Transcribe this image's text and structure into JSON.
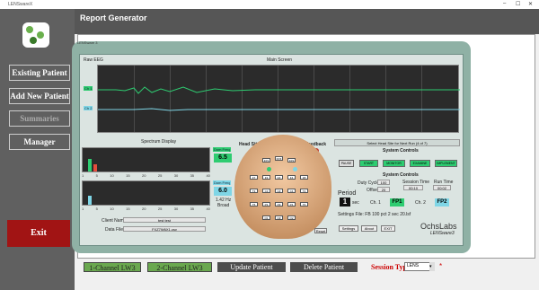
{
  "window": {
    "title": "LENSwareX",
    "controls": [
      "–",
      "☐",
      "✕"
    ]
  },
  "app": {
    "report_title": "Report Generator"
  },
  "sidebar": {
    "buttons": [
      {
        "label": "Existing Patient",
        "bg": "#6aa84f"
      },
      {
        "label": "Add New Patient",
        "bg": "#7a7a7a"
      },
      {
        "label": "Summaries",
        "bg": "#7a7a7a"
      },
      {
        "label": "Manager",
        "bg": "#7a7a7a"
      }
    ],
    "exit": "Exit"
  },
  "bottom": {
    "buttons": [
      "1-Channel LW3",
      "2-Channel LW3",
      "Update Patient",
      "Delete Patient"
    ],
    "session_label": "Session Type:",
    "session_value": "LENS",
    "asterisk": "*"
  },
  "lens": {
    "tab": "Existing Patient",
    "title": "LENSware 3",
    "raw_eeg": "Raw EEG",
    "main_screen": "Main Screen",
    "ch1": "Ch 1",
    "ch2": "Ch 2",
    "spectrum_title": "Spectrum Display",
    "spectrum_ticks": [
      "1",
      "5",
      "10",
      "15",
      "20",
      "25",
      "30",
      "35",
      "40"
    ],
    "dom_freq_label": "Dom Freq",
    "dom_freq_1": "6.5",
    "dom_freq_2": "6.0",
    "dom_freq_2_sub": "1.42 Hz",
    "dom_freq_2_sub2": "Broad",
    "head_sites": "Head Sites",
    "feedback": "Feedback",
    "sites": [
      "FP1",
      "FPZ",
      "FP2",
      "F7",
      "F3",
      "FZ",
      "F4",
      "F8",
      "T3",
      "C3",
      "CZ",
      "C4",
      "T4",
      "T5",
      "P3",
      "PZ",
      "P4",
      "T6",
      "O1",
      "OZ",
      "O2"
    ],
    "reset": "Reset",
    "select_head_site": "Select Head Site for Next Run (4 of 7)",
    "system_controls": "System Controls",
    "sys_buttons": [
      "PAUSE",
      "START",
      "MONITOR",
      "EXAMINE",
      "IMPLEMENT"
    ],
    "system_controls_2": "System Controls",
    "duty_cycle_label": "Duty Cycle",
    "duty_cycle": "100",
    "offset_label": "Offset",
    "offset": "20",
    "session_time_label": "Session Time",
    "session_time": "00:10",
    "run_time_label": "Run Time",
    "run_time": "00:02",
    "period_label": "Period",
    "period": "1",
    "period_unit": "sec",
    "ch1_label": "Ch. 1",
    "ch1_site": "FP1",
    "ch2_label": "Ch. 2",
    "ch2_site": "FP2",
    "settings_file": "Settings File: FB 100 pct 2 sec 20.lsf",
    "client_name_label": "Client Name:",
    "client_name": "test test",
    "data_file_label": "Data File:",
    "data_file": "FXZ7W6X1.csv",
    "settings_btn": "Settings",
    "about_btn": "About",
    "exit_btn": "EXIT",
    "brand": "OchsLabs",
    "brand_sub": "LENSware3"
  }
}
